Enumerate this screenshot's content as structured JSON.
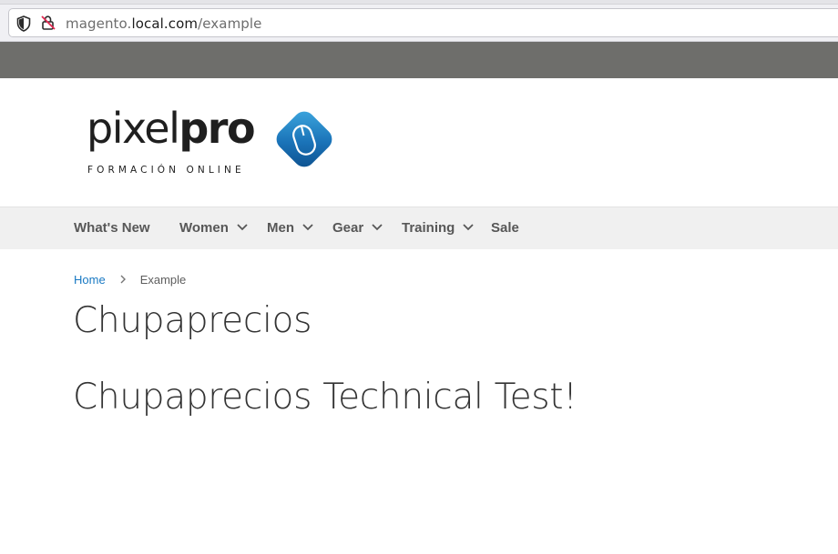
{
  "browser": {
    "url_prefix": "magento.",
    "url_domain": "local.com",
    "url_path": "/example",
    "icons": [
      "shield-icon",
      "insecure-lock-icon"
    ]
  },
  "logo": {
    "word_light": "pixel",
    "word_bold": "pro",
    "tagline": "FORMACIÓN ONLINE",
    "icon": "mouse-logo-icon",
    "accent_color": "#1a73b8"
  },
  "nav": {
    "items": [
      {
        "label": "What's New",
        "has_dropdown": false
      },
      {
        "label": "Women",
        "has_dropdown": true
      },
      {
        "label": "Men",
        "has_dropdown": true
      },
      {
        "label": "Gear",
        "has_dropdown": true
      },
      {
        "label": "Training",
        "has_dropdown": true
      },
      {
        "label": "Sale",
        "has_dropdown": false
      }
    ]
  },
  "breadcrumb": {
    "home": "Home",
    "current": "Example"
  },
  "page": {
    "title": "Chupaprecios",
    "heading": "Chupaprecios Technical Test!"
  },
  "colors": {
    "link": "#1979c3",
    "panel_bar": "#6e6e6b",
    "nav_bg": "#f0f0f0"
  }
}
